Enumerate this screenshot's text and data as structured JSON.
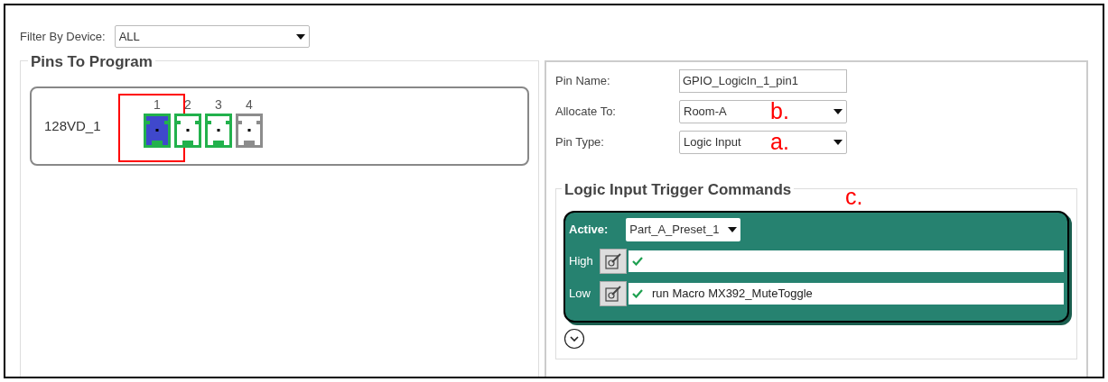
{
  "filter": {
    "label": "Filter By Device:",
    "value": "ALL"
  },
  "pins_group": {
    "title": "Pins To Program",
    "devices": [
      {
        "name": "128VD_1",
        "pins": [
          {
            "label": "1",
            "selected": true,
            "annotated": true,
            "color": "#22b14c"
          },
          {
            "label": "2",
            "selected": false,
            "annotated": false,
            "color": "#22b14c"
          },
          {
            "label": "3",
            "selected": false,
            "annotated": false,
            "color": "#22b14c"
          },
          {
            "label": "4",
            "selected": false,
            "annotated": false,
            "color": "#8c8c8c"
          }
        ]
      }
    ]
  },
  "properties": {
    "fields": [
      {
        "kind": "text",
        "label": "Pin Name:",
        "value": "GPIO_LogicIn_1_pin1"
      },
      {
        "kind": "dropdown",
        "label": "Allocate To:",
        "value": "Room-A",
        "annotation": "b."
      },
      {
        "kind": "dropdown",
        "label": "Pin Type:",
        "value": "Logic Input",
        "annotation": "a."
      }
    ]
  },
  "triggers": {
    "title": "Logic Input Trigger Commands",
    "annotation": "c.",
    "active_label": "Active:",
    "active_value": "Part_A_Preset_1",
    "commands": [
      {
        "label": "High",
        "ok": true
      },
      {
        "label": "Low",
        "ok": true,
        "command": "run Macro MX392_MuteToggle"
      }
    ]
  }
}
